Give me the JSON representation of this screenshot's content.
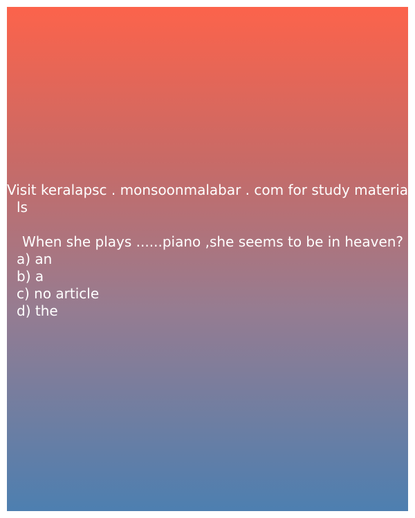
{
  "card": {
    "gradient": {
      "top": "#fc634b",
      "bottom": "#4d7fb0"
    },
    "text_color": "#ffffff"
  },
  "promo": {
    "line1": "Visit keralapsc . monsoonmalabar . com for study materia",
    "line2": "ls"
  },
  "question": {
    "text": "When she plays ......piano ,she seems to be in heaven?"
  },
  "options": [
    {
      "label": "a) an"
    },
    {
      "label": "b) a"
    },
    {
      "label": "c) no article"
    },
    {
      "label": "d) the"
    }
  ]
}
